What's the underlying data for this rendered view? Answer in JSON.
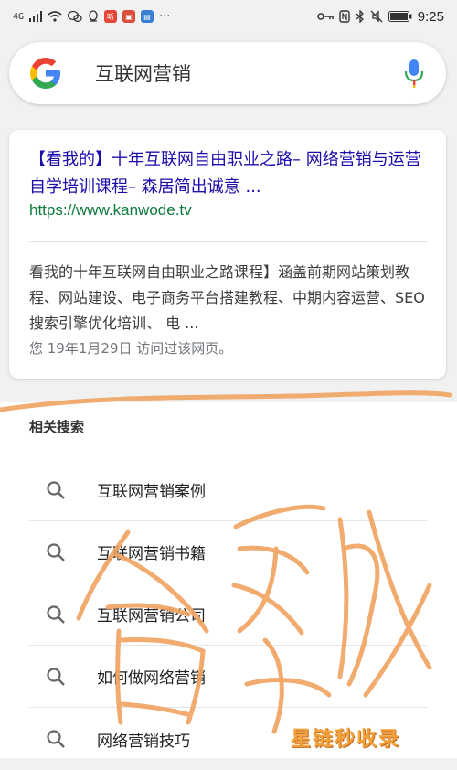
{
  "status_bar": {
    "signal_label": "4G",
    "notification_icons": [
      "wechat-icon",
      "qq-icon",
      "ting-app-icon",
      "kuaibao-app-icon",
      "news-app-icon"
    ],
    "more": "···",
    "system_icons": [
      "key-icon",
      "nfc-icon",
      "bluetooth-icon",
      "mute-icon",
      "battery-icon"
    ],
    "time": "9:25"
  },
  "search": {
    "query": "互联网营销"
  },
  "result": {
    "title": "【看我的】十年互联网自由职业之路– 网络营销与运营自学培训课程– 森居简出诚意 ...",
    "url": "https://www.kanwode.tv",
    "snippet": "看我的十年互联网自由职业之路课程】涵盖前期网站策划教程、网站建设、电子商务平台搭建教程、中期内容运营、SEO搜索引擎优化培训、 电 ...",
    "visited": "您 19年1月29日 访问过该网页。"
  },
  "related": {
    "heading": "相关搜索",
    "items": [
      {
        "label": "互联网营销案例"
      },
      {
        "label": "互联网营销书籍"
      },
      {
        "label": "互联网营销公司"
      },
      {
        "label": "如何做网络营销"
      },
      {
        "label": "网络营销技巧"
      }
    ]
  },
  "colors": {
    "link": "#1a0dab",
    "url": "#0b7a3a",
    "scribble": "#f0a360"
  },
  "watermark": "星链秒收录"
}
